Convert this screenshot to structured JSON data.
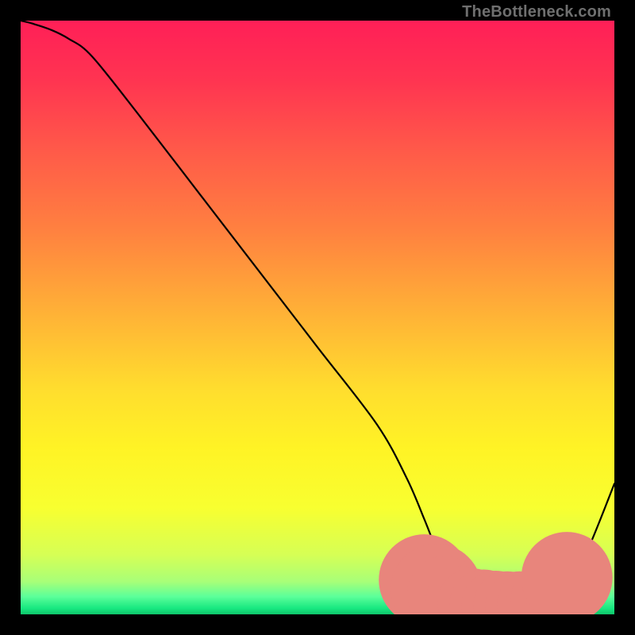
{
  "watermark": "TheBottleneck.com",
  "colors": {
    "gradient_stops": [
      {
        "offset": 0.0,
        "color": "#ff1f57"
      },
      {
        "offset": 0.1,
        "color": "#ff3451"
      },
      {
        "offset": 0.22,
        "color": "#ff5a49"
      },
      {
        "offset": 0.35,
        "color": "#ff8040"
      },
      {
        "offset": 0.5,
        "color": "#ffb436"
      },
      {
        "offset": 0.62,
        "color": "#ffdd2e"
      },
      {
        "offset": 0.72,
        "color": "#fff325"
      },
      {
        "offset": 0.82,
        "color": "#f8ff30"
      },
      {
        "offset": 0.9,
        "color": "#d6ff55"
      },
      {
        "offset": 0.945,
        "color": "#a8ff78"
      },
      {
        "offset": 0.97,
        "color": "#5cff9a"
      },
      {
        "offset": 0.99,
        "color": "#17e880"
      },
      {
        "offset": 1.0,
        "color": "#0fc46a"
      }
    ],
    "curve": "#000000",
    "marker_fill": "#e8857c",
    "marker_stroke": "#c96a63"
  },
  "chart_data": {
    "type": "line",
    "title": "",
    "xlabel": "",
    "ylabel": "",
    "xlim": [
      0,
      100
    ],
    "ylim": [
      0,
      100
    ],
    "series": [
      {
        "name": "bottleneck-curve",
        "x": [
          0,
          2,
          5,
          8,
          12,
          20,
          30,
          40,
          50,
          60,
          65,
          68,
          70,
          72,
          75,
          78,
          80,
          82,
          84,
          86,
          88,
          90,
          93,
          96,
          100
        ],
        "y": [
          100,
          99.5,
          98.5,
          97,
          94,
          84,
          71,
          58,
          45,
          32,
          23,
          16,
          11,
          7,
          4,
          2.2,
          1.5,
          1.2,
          1.1,
          1.1,
          1.4,
          2.5,
          6,
          12,
          22
        ]
      }
    ],
    "markers": {
      "name": "highlight-band",
      "points": [
        {
          "x": 68,
          "y": 5.8,
          "r": 2.4
        },
        {
          "x": 69,
          "y": 5.0,
          "r": 2.0
        },
        {
          "x": 70,
          "y": 4.2,
          "r": 2.4
        },
        {
          "x": 71.5,
          "y": 3.4,
          "r": 2.0
        },
        {
          "x": 74,
          "y": 2.4,
          "r": 1.8
        },
        {
          "x": 76,
          "y": 2.0,
          "r": 1.8
        },
        {
          "x": 78,
          "y": 1.8,
          "r": 1.8
        },
        {
          "x": 80,
          "y": 1.6,
          "r": 1.8
        },
        {
          "x": 82,
          "y": 1.5,
          "r": 1.8
        },
        {
          "x": 84,
          "y": 1.5,
          "r": 1.8
        },
        {
          "x": 86,
          "y": 1.7,
          "r": 1.8
        },
        {
          "x": 87.5,
          "y": 2.0,
          "r": 1.8
        },
        {
          "x": 89,
          "y": 2.6,
          "r": 2.0
        },
        {
          "x": 91,
          "y": 4.5,
          "r": 2.0
        },
        {
          "x": 92,
          "y": 6.2,
          "r": 2.4
        }
      ]
    }
  }
}
